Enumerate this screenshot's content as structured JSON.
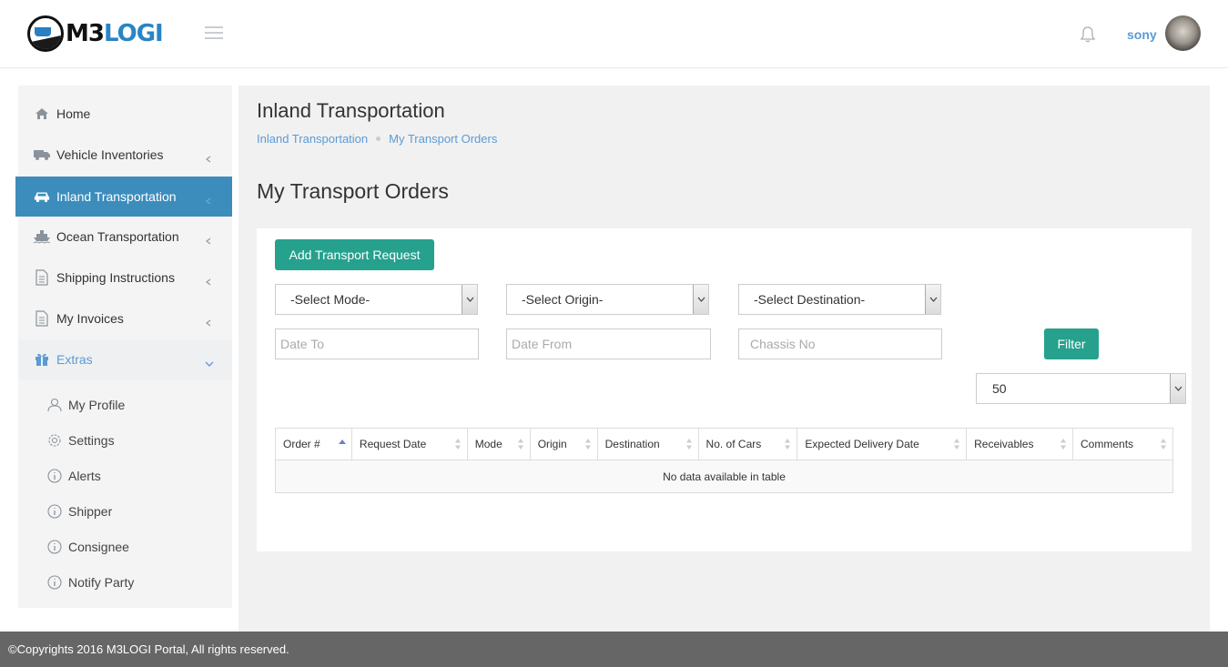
{
  "header": {
    "logo_text_a": "M3",
    "logo_text_b": "LOGI",
    "username": "sony"
  },
  "sidebar": {
    "items": [
      {
        "label": "Home",
        "icon": "home-icon"
      },
      {
        "label": "Vehicle Inventories",
        "icon": "truck-icon"
      },
      {
        "label": "Inland Transportation",
        "icon": "car-icon"
      },
      {
        "label": "Ocean Transportation",
        "icon": "ship-icon"
      },
      {
        "label": "Shipping Instructions",
        "icon": "document-icon"
      },
      {
        "label": "My Invoices",
        "icon": "document-icon"
      },
      {
        "label": "Extras",
        "icon": "gift-icon"
      }
    ],
    "sub_items": [
      {
        "label": "My Profile",
        "icon": "user-icon"
      },
      {
        "label": "Settings",
        "icon": "gear-icon"
      },
      {
        "label": "Alerts",
        "icon": "info-icon"
      },
      {
        "label": "Shipper",
        "icon": "info-icon"
      },
      {
        "label": "Consignee",
        "icon": "info-icon"
      },
      {
        "label": "Notify Party",
        "icon": "info-icon"
      }
    ]
  },
  "main": {
    "page_title": "Inland Transportation",
    "breadcrumb": [
      "Inland Transportation",
      "My Transport Orders"
    ],
    "section_title": "My Transport Orders",
    "add_button": "Add Transport Request",
    "selects": {
      "mode": "-Select Mode-",
      "origin": "-Select Origin-",
      "destination": "-Select Destination-"
    },
    "inputs": {
      "date_to": "Date To",
      "date_from": "Date From",
      "chassis": "Chassis No"
    },
    "filter_button": "Filter",
    "page_size": "50",
    "table": {
      "columns": [
        "Order #",
        "Request Date",
        "Mode",
        "Origin",
        "Destination",
        "No. of Cars",
        "Expected Delivery Date",
        "Receivables",
        "Comments"
      ],
      "empty_message": "No data available in table"
    }
  },
  "footer": {
    "text": "©Copyrights 2016 M3LOGI Portal, All rights reserved."
  },
  "colors": {
    "accent": "#3c8dbc",
    "button": "#25a18e",
    "link": "#5b9bd5",
    "footer": "#666666"
  }
}
